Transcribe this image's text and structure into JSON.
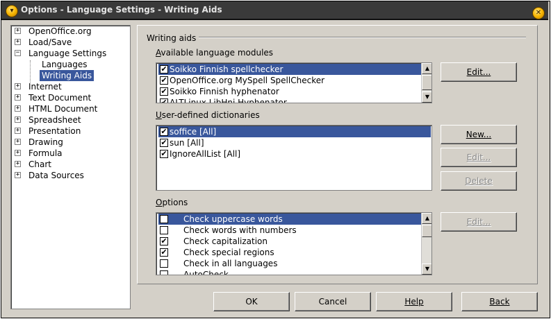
{
  "window": {
    "title": "Options - Language Settings - Writing Aids"
  },
  "tree": {
    "items": [
      {
        "label": "OpenOffice.org",
        "expander": "+"
      },
      {
        "label": "Load/Save",
        "expander": "+"
      },
      {
        "label": "Language Settings",
        "expander": "−"
      },
      {
        "label": "Languages",
        "expander": ""
      },
      {
        "label": "Writing Aids",
        "expander": "",
        "selected": true
      },
      {
        "label": "Internet",
        "expander": "+"
      },
      {
        "label": "Text Document",
        "expander": "+"
      },
      {
        "label": "HTML Document",
        "expander": "+"
      },
      {
        "label": "Spreadsheet",
        "expander": "+"
      },
      {
        "label": "Presentation",
        "expander": "+"
      },
      {
        "label": "Drawing",
        "expander": "+"
      },
      {
        "label": "Formula",
        "expander": "+"
      },
      {
        "label": "Chart",
        "expander": "+"
      },
      {
        "label": "Data Sources",
        "expander": "+"
      }
    ]
  },
  "writing_aids": {
    "group_title": "Writing aids",
    "modules": {
      "label_first": "A",
      "label_rest": "vailable language modules",
      "items": [
        {
          "label": "Soikko Finnish spellchecker",
          "checked": "✔"
        },
        {
          "label": "OpenOffice.org MySpell SpellChecker",
          "checked": "✔"
        },
        {
          "label": "Soikko Finnish hyphenator",
          "checked": "✔"
        },
        {
          "label": "ALTLinux LibHnj Hyphenator",
          "checked": "✔"
        }
      ],
      "edit_button": "Edit..."
    },
    "dictionaries": {
      "label_first": "U",
      "label_rest": "ser-defined dictionaries",
      "items": [
        {
          "label": "soffice [All]",
          "checked": "✔"
        },
        {
          "label": "sun [All]",
          "checked": "✔"
        },
        {
          "label": "IgnoreAllList [All]",
          "checked": "✔"
        }
      ],
      "new_button": "New...",
      "edit_button": "Edit...",
      "delete_button": "Delete"
    },
    "options": {
      "label_first": "O",
      "label_rest": "ptions",
      "items": [
        {
          "label": "Check uppercase words",
          "checked": ""
        },
        {
          "label": "Check words with numbers",
          "checked": ""
        },
        {
          "label": "Check capitalization",
          "checked": "✔"
        },
        {
          "label": "Check special regions",
          "checked": "✔"
        },
        {
          "label": "Check in all languages",
          "checked": ""
        },
        {
          "label": "AutoCheck",
          "checked": ""
        }
      ],
      "edit_button": "Edit..."
    }
  },
  "footer": {
    "ok": "OK",
    "cancel": "Cancel",
    "help": "Help",
    "back": "Back"
  },
  "colors": {
    "selection": "#39579c",
    "titlebar": "#3a3a3a",
    "dialog_bg": "#d4d0c8"
  }
}
